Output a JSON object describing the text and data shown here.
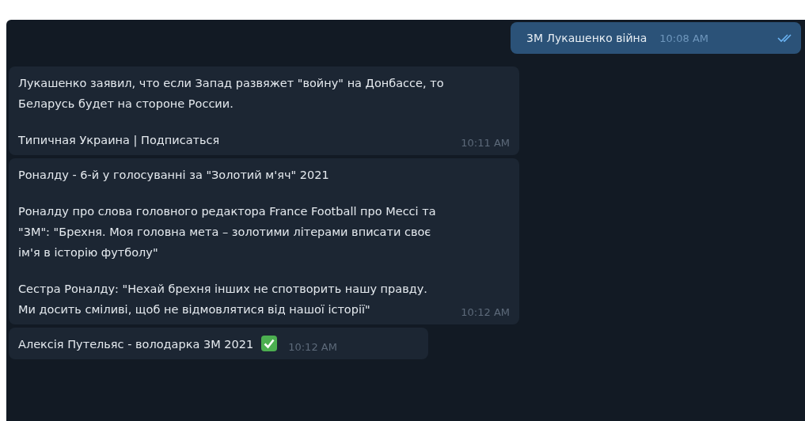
{
  "outgoing": {
    "text": "3М Лукашенко війна",
    "time": "10:08 AM",
    "read": true
  },
  "messages": [
    {
      "paragraphs": [
        "Лукашенко заявил, что если Запад развяжет \"войну\" на Донбассе, то Беларусь будет на стороне России.",
        "Типичная Украина | Подписаться"
      ],
      "time": "10:11 AM",
      "check_emoji": false
    },
    {
      "paragraphs": [
        "Роналду - 6-й у голосуванні за \"Золотий м'яч\" 2021",
        "Роналду про слова головного редактора France Football про Мессі та \"3М\": \"Брехня. Моя головна мета – золотими літерами вписати своє ім'я в історію футболу\"",
        "Сестра Роналду: \"Нехай брехня інших не спотворить нашу правду. Ми досить сміливі, щоб не відмовлятися від нашої історії\""
      ],
      "time": "10:12 AM",
      "check_emoji": false
    },
    {
      "paragraphs": [
        "Алексія Путельяс - володарка 3М 2021"
      ],
      "time": "10:12 AM",
      "check_emoji": true
    }
  ]
}
